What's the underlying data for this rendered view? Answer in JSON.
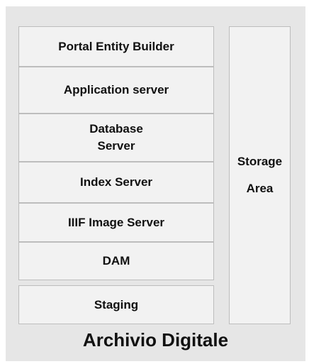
{
  "layers": [
    "Portal Entity Builder",
    "Application server",
    "Database\nServer",
    "Index Server",
    "IIIF Image Server",
    "DAM",
    "Staging"
  ],
  "side_block": "Storage\nArea",
  "caption": "Archivio Digitale",
  "colors": {
    "background": "#e6e6e6",
    "box_fill": "#f2f2f2",
    "box_border": "#bdbdbd",
    "text": "#111111"
  }
}
